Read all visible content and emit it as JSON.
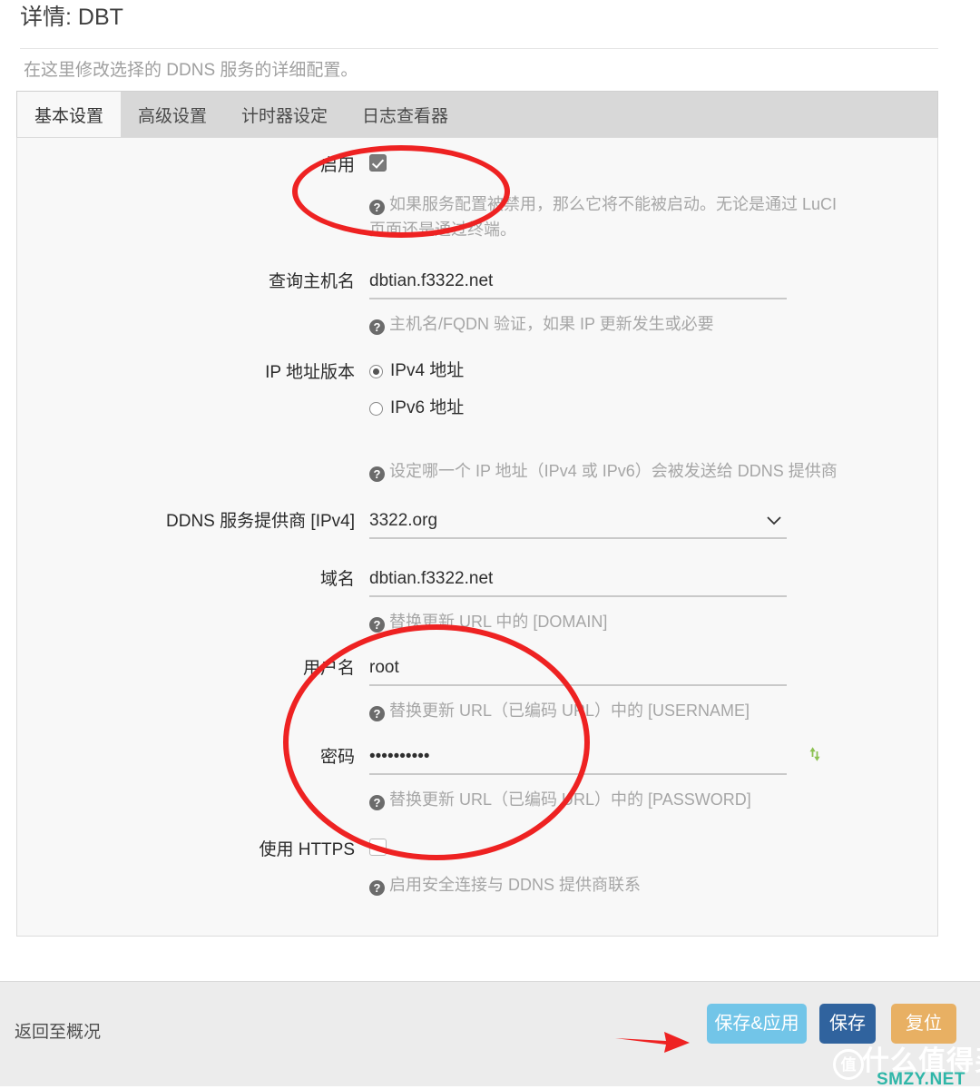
{
  "header": {
    "title": "详情: DBT",
    "description": "在这里修改选择的 DDNS 服务的详细配置。"
  },
  "tabs": [
    {
      "label": "基本设置",
      "active": true
    },
    {
      "label": "高级设置",
      "active": false
    },
    {
      "label": "计时器设定",
      "active": false
    },
    {
      "label": "日志查看器",
      "active": false
    }
  ],
  "form": {
    "enabled": {
      "label": "启用",
      "checked": true,
      "hint": "如果服务配置被禁用，那么它将不能被启动。无论是通过 LuCI 页面还是通过终端。"
    },
    "lookup_host": {
      "label": "查询主机名",
      "value": "dbtian.f3322.net",
      "placeholder": "",
      "hint": "主机名/FQDN 验证，如果 IP 更新发生或必要"
    },
    "ip_version": {
      "label": "IP 地址版本",
      "options": [
        {
          "label": "IPv4 地址",
          "selected": true
        },
        {
          "label": "IPv6 地址",
          "selected": false
        }
      ],
      "hint": "设定哪一个 IP 地址（IPv4 或 IPv6）会被发送给 DDNS 提供商"
    },
    "provider": {
      "label": "DDNS 服务提供商 [IPv4]",
      "value": "3322.org",
      "options": [
        "3322.org"
      ],
      "chevron_icon": "chevron-down-icon"
    },
    "domain": {
      "label": "域名",
      "value": "dbtian.f3322.net",
      "placeholder": "",
      "hint": "替换更新 URL 中的 [DOMAIN]"
    },
    "username": {
      "label": "用户名",
      "value": "root",
      "placeholder": "",
      "hint": "替换更新 URL（已编码 URL）中的 [USERNAME]"
    },
    "password": {
      "label": "密码",
      "value": "••••••••••",
      "placeholder": "",
      "hint": "替换更新 URL（已编码 URL）中的 [PASSWORD]",
      "regen_icon": "refresh-icon"
    },
    "use_https": {
      "label": "使用 HTTPS",
      "checked": false,
      "hint": "启用安全连接与 DDNS 提供商联系"
    }
  },
  "footer": {
    "back_link": "返回至概况",
    "buttons": [
      {
        "label": "保存&应用",
        "color": "#72c5e8"
      },
      {
        "label": "保存",
        "color": "#30639e"
      },
      {
        "label": "复位",
        "color": "#e8b063"
      }
    ]
  },
  "annotations": {
    "highlight_color": "#ee2222",
    "ellipse_enable": "启用",
    "ellipse_credentials": "用户名/密码",
    "arrow_target": "保存&应用"
  },
  "watermark": {
    "mark": "值",
    "text": "什么值得买",
    "url": "SMZY.NET",
    "url_color": "#2fb6a8"
  }
}
